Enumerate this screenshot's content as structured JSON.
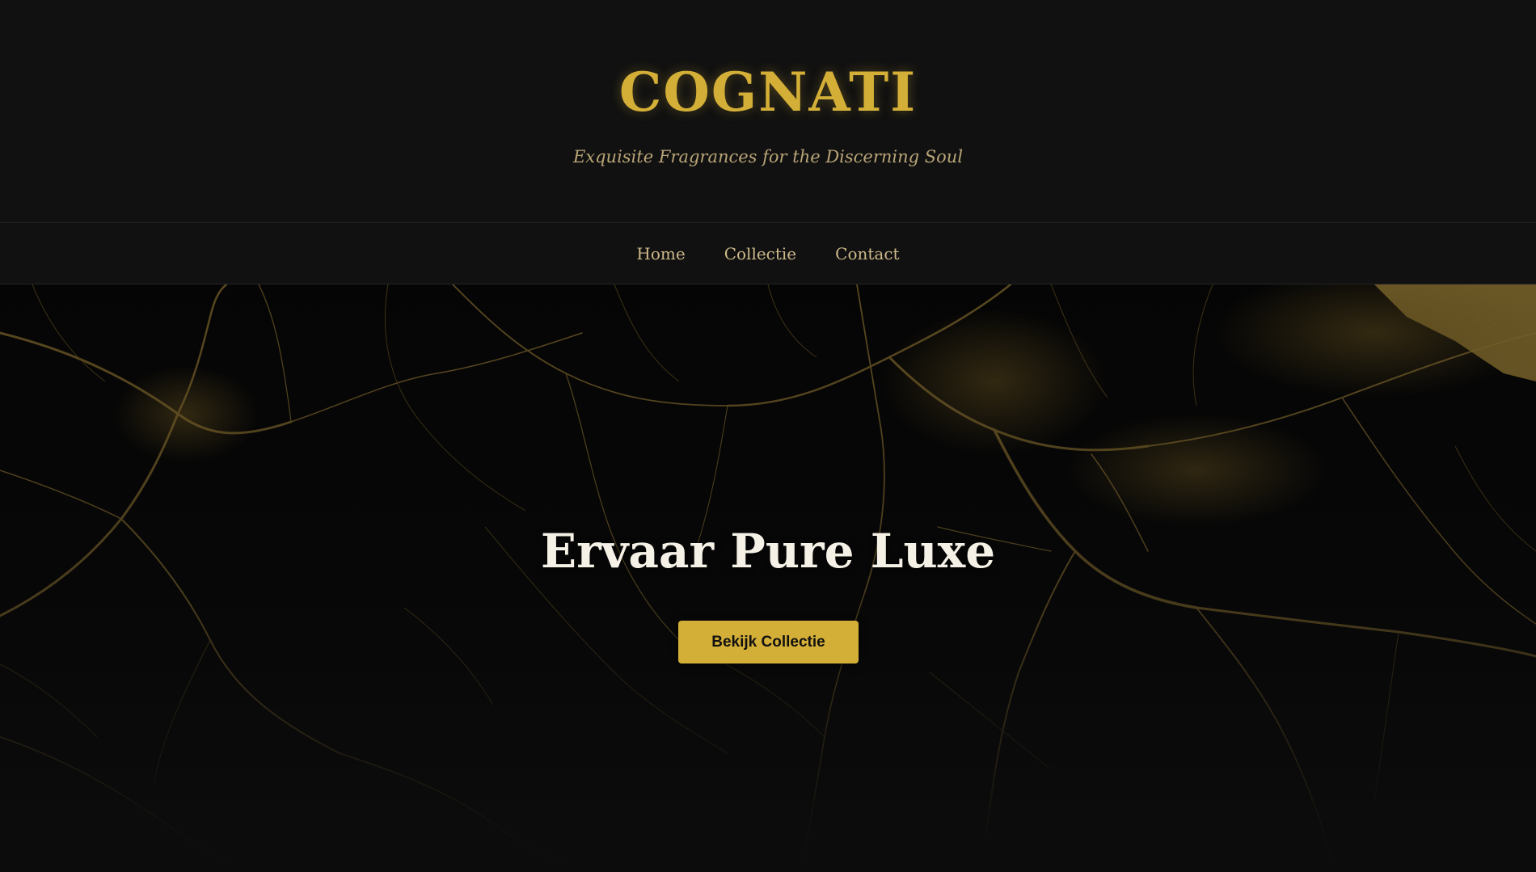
{
  "header": {
    "logo": "COGNATI",
    "tagline": "Exquisite Fragrances for the Discerning Soul"
  },
  "nav": {
    "items": [
      {
        "label": "Home"
      },
      {
        "label": "Collectie"
      },
      {
        "label": "Contact"
      }
    ]
  },
  "hero": {
    "title": "Ervaar Pure Luxe",
    "button_label": "Bekijk Collectie",
    "background": "black-gold-marble-texture"
  },
  "colors": {
    "accent_gold": "#d4af37",
    "background": "#111111",
    "hero_title": "#f5f1e6",
    "nav_text": "#cdb98a"
  }
}
